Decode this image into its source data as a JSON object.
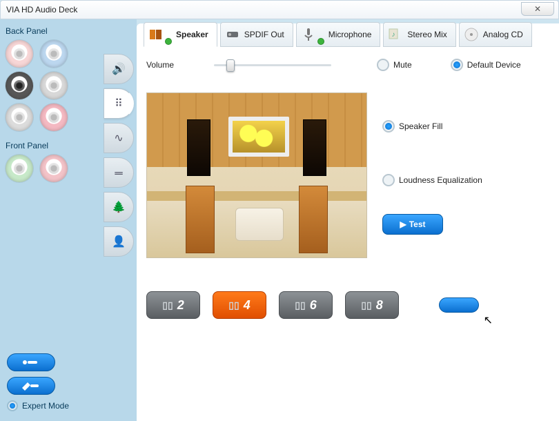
{
  "window": {
    "title": "VIA HD Audio Deck",
    "close_glyph": "✕"
  },
  "left": {
    "back_label": "Back Panel",
    "front_label": "Front Panel",
    "back_ports": [
      {
        "color": "#f7d6d6",
        "plugged": false
      },
      {
        "color": "#bcd7ef",
        "plugged": false
      },
      {
        "color": "#575757",
        "plugged": true
      },
      {
        "color": "#d8d8d8",
        "plugged": false
      },
      {
        "color": "#dcdcdc",
        "plugged": false
      },
      {
        "color": "#f4b9c2",
        "plugged": false
      }
    ],
    "front_ports": [
      {
        "color": "#c7e9c9",
        "plugged": false
      },
      {
        "color": "#f3c3c8",
        "plugged": false
      }
    ],
    "expert_label": "Expert Mode",
    "expert_on": true
  },
  "sidetabs": [
    {
      "name": "volume",
      "glyph": "🔊"
    },
    {
      "name": "channels",
      "glyph": "⠿",
      "active": true
    },
    {
      "name": "tone",
      "glyph": "∿"
    },
    {
      "name": "eq",
      "glyph": "𝍡"
    },
    {
      "name": "env",
      "glyph": "🌲"
    },
    {
      "name": "room",
      "glyph": "👤"
    }
  ],
  "tabs": [
    {
      "name": "speaker",
      "label": "Speaker",
      "active": true,
      "check": true
    },
    {
      "name": "spdif",
      "label": "SPDIF Out",
      "active": false,
      "check": false
    },
    {
      "name": "mic",
      "label": "Microphone",
      "active": false,
      "check": true
    },
    {
      "name": "stereomix",
      "label": "Stereo Mix",
      "active": false,
      "check": false
    },
    {
      "name": "analogcd",
      "label": "Analog CD",
      "active": false,
      "check": false
    }
  ],
  "content": {
    "volume_label": "Volume",
    "mute_label": "Mute",
    "mute_on": false,
    "default_label": "Default Device",
    "default_on": true,
    "speaker_fill_label": "Speaker Fill",
    "speaker_fill_on": true,
    "loudness_label": "Loudness Equalization",
    "loudness_on": false,
    "test_label": "Test",
    "configs": [
      {
        "value": "2",
        "active": false
      },
      {
        "value": "4",
        "active": true
      },
      {
        "value": "6",
        "active": false
      },
      {
        "value": "8",
        "active": false
      }
    ]
  }
}
